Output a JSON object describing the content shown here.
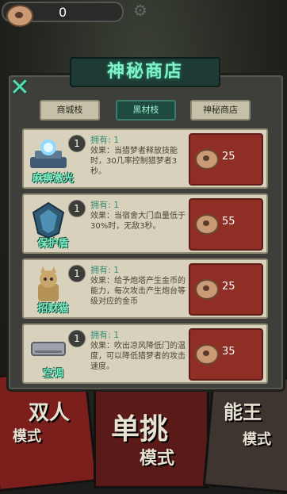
{
  "hud": {
    "coins": "0"
  },
  "shop": {
    "title": "神秘商店",
    "tabs": [
      "商城枝",
      "黑材枝",
      "神秘商店"
    ],
    "items": [
      {
        "name": "麻痹激光",
        "level": "1",
        "own_label": "拥有:",
        "own_value": "1",
        "effect": "效果：当猎梦者释放技能时，30几率控制猎梦者3秒。",
        "price": "25"
      },
      {
        "name": "保护盾",
        "level": "1",
        "own_label": "拥有:",
        "own_value": "1",
        "effect": "效果：当宿舍大门血量低于30%时，无敌3秒。",
        "price": "55"
      },
      {
        "name": "招财猫",
        "level": "1",
        "own_label": "拥有:",
        "own_value": "1",
        "effect": "效果：给予炮塔产生金币的能力，每次攻击产生炮台等级对应的金币",
        "price": "25"
      },
      {
        "name": "空调",
        "level": "1",
        "own_label": "拥有:",
        "own_value": "1",
        "effect": "效果：吹出凉风降低门的温度，可以降低猎梦者的攻击速度。",
        "price": "35"
      }
    ]
  },
  "background": {
    "mode_left": "双人\n模式",
    "mode_mid": "单挑\n模式",
    "mode_right": "能王\n模式"
  }
}
